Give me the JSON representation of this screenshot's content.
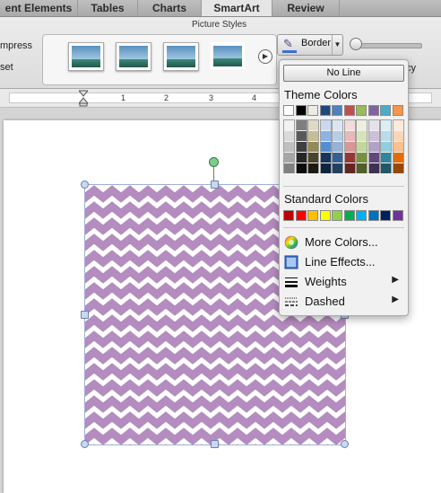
{
  "tabs": [
    {
      "label": "ent Elements"
    },
    {
      "label": "Tables"
    },
    {
      "label": "Charts"
    },
    {
      "label": "SmartArt"
    },
    {
      "label": "Review"
    }
  ],
  "ribbon": {
    "group_title": "Picture Styles",
    "compress_label": "mpress",
    "reset_label": "set",
    "border_label": "Border",
    "transparency_label_fragment": "cy"
  },
  "ruler": {
    "numbers": [
      "1",
      "2",
      "3",
      "4"
    ]
  },
  "border_menu": {
    "no_line": "No Line",
    "theme_colors_title": "Theme Colors",
    "standard_colors_title": "Standard Colors",
    "theme_colors": [
      "#ffffff",
      "#000000",
      "#eeece1",
      "#1f497d",
      "#4f81bd",
      "#c0504d",
      "#9bbb59",
      "#8064a2",
      "#4bacc6",
      "#f79646"
    ],
    "theme_shades": [
      [
        "#f2f2f2",
        "#d9d9d9",
        "#bfbfbf",
        "#a6a6a6",
        "#808080"
      ],
      [
        "#7f7f7f",
        "#595959",
        "#3f3f3f",
        "#262626",
        "#0d0d0d"
      ],
      [
        "#ddd9c3",
        "#c4bd97",
        "#948a54",
        "#4a452a",
        "#1d1b10"
      ],
      [
        "#c6d9f0",
        "#8db3e2",
        "#548dd4",
        "#17365d",
        "#0f243e"
      ],
      [
        "#dbe5f1",
        "#b8cce4",
        "#95b3d7",
        "#366092",
        "#244061"
      ],
      [
        "#f2dcdb",
        "#e5b9b7",
        "#d99694",
        "#953734",
        "#632423"
      ],
      [
        "#ebf1dd",
        "#d7e3bc",
        "#c3d69b",
        "#76923c",
        "#4f6128"
      ],
      [
        "#e5e0ec",
        "#ccc1d9",
        "#b2a2c7",
        "#5f497a",
        "#3f3151"
      ],
      [
        "#dbeef3",
        "#b7dde8",
        "#92cddc",
        "#31859b",
        "#205867"
      ],
      [
        "#fdeada",
        "#fbd5b5",
        "#fac08f",
        "#e36c09",
        "#974806"
      ]
    ],
    "standard_colors": [
      "#c00000",
      "#ff0000",
      "#ffc000",
      "#ffff00",
      "#92d050",
      "#00b050",
      "#00b0f0",
      "#0070c0",
      "#002060",
      "#7030a0"
    ],
    "items": [
      {
        "label": "More Colors...",
        "icon": "color-wheel-icon"
      },
      {
        "label": "Line Effects...",
        "icon": "line-effects-icon"
      },
      {
        "label": "Weights",
        "icon": "weights-icon",
        "submenu": true
      },
      {
        "label": "Dashed",
        "icon": "dashed-icon",
        "submenu": true
      }
    ]
  },
  "picture": {
    "pattern": "purple chevron",
    "pattern_color": "#b58cbf"
  }
}
